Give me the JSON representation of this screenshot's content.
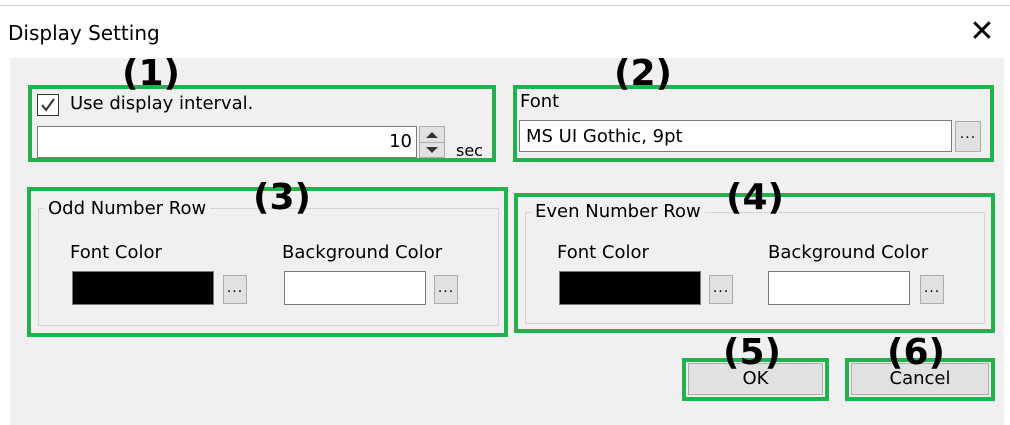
{
  "window": {
    "title": "Display Setting",
    "close_glyph": "✕"
  },
  "annotations": {
    "a1": "(1)",
    "a2": "(2)",
    "a3": "(3)",
    "a4": "(4)",
    "a5": "(5)",
    "a6": "(6)"
  },
  "interval": {
    "checkbox_label": "Use display interval.",
    "checked": true,
    "value": "10",
    "unit": "sec"
  },
  "font": {
    "label": "Font",
    "value": "MS UI Gothic, 9pt",
    "browse": "..."
  },
  "odd_row": {
    "legend": "Odd Number Row",
    "font_color_label": "Font Color",
    "background_color_label": "Background Color",
    "font_color": "#000000",
    "background_color": "#ffffff",
    "browse": "..."
  },
  "even_row": {
    "legend": "Even Number Row",
    "font_color_label": "Font Color",
    "background_color_label": "Background Color",
    "font_color": "#000000",
    "background_color": "#ffffff",
    "browse": "..."
  },
  "buttons": {
    "ok": "OK",
    "cancel": "Cancel"
  },
  "colors": {
    "annotation_green": "#22b14c",
    "dialog_bg": "#f0f0f0"
  }
}
